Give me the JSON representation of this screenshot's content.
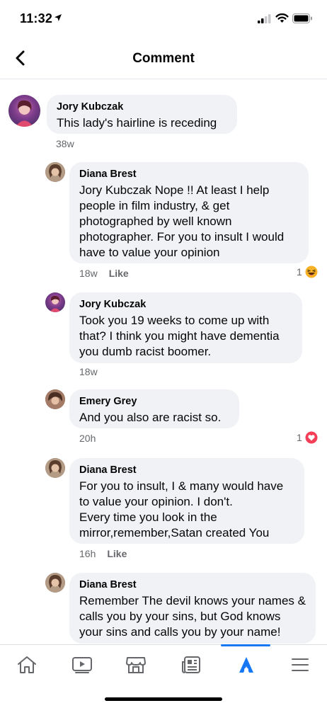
{
  "status_bar": {
    "time": "11:32"
  },
  "header": {
    "title": "Comment"
  },
  "comments": [
    {
      "author": "Jory Kubczak",
      "text": "This lady's hairline is receding",
      "time": "38w"
    },
    {
      "author": "Diana Brest",
      "text": "Jory Kubczak Nope !!  At least I help people in film industry, & get photographed by well known photographer. For you to insult I would have to value your opinion",
      "time": "18w",
      "like": "Like",
      "reaction_count": "1"
    },
    {
      "author": "Jory Kubczak",
      "text": "Took you 19 weeks to come up with that? I think you might have dementia you dumb racist boomer.",
      "time": "18w"
    },
    {
      "author": "Emery Grey",
      "text": "And you also are racist so.",
      "time": "20h",
      "reaction_count": "1"
    },
    {
      "author": "Diana Brest",
      "text": "For you to insult, I & many would have to value your opinion. I don't.\nEvery time you look in the mirror,remember,Satan created You",
      "time": "16h",
      "like": "Like"
    },
    {
      "author": "Diana Brest",
      "text": "Remember The devil knows your names & calls you by your sins, but God knows your sins and calls you by your name!"
    }
  ],
  "tabbar": {
    "tabs": [
      "home-icon",
      "video-icon",
      "marketplace-icon",
      "news-icon",
      "profile-icon",
      "menu-icon"
    ],
    "active": "profile-icon"
  },
  "colors": {
    "accent": "#1877f2",
    "bubble": "#f0f2f5",
    "meta": "#65676b",
    "love": "#f33e58",
    "haha": "#f7b125"
  }
}
